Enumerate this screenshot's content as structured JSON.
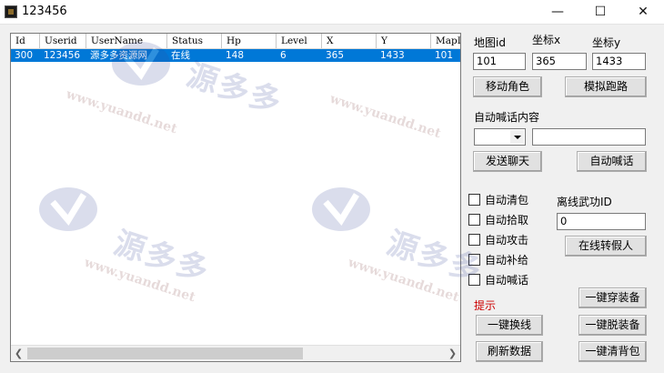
{
  "window": {
    "title": "123456",
    "minimize_glyph": "—",
    "maximize_glyph": "☐",
    "close_glyph": "✕"
  },
  "list": {
    "columns": [
      "Id",
      "Userid",
      "UserName",
      "Status",
      "Hp",
      "Level",
      "X",
      "Y",
      "MapId"
    ],
    "rows": [
      [
        "300",
        "123456",
        "源多多资源网",
        "在线",
        "148",
        "6",
        "365",
        "1433",
        "101"
      ]
    ]
  },
  "panel": {
    "map_id_label": "地图id",
    "x_label": "坐标x",
    "y_label": "坐标y",
    "map_id_value": "101",
    "x_value": "365",
    "y_value": "1433",
    "move_button": "移动角色",
    "sim_run_button": "模拟跑路",
    "shout_content_label": "自动喊话内容",
    "chat_channel_value": "",
    "chat_text_value": "",
    "send_chat_button": "发送聊天",
    "auto_shout_button": "自动喊话",
    "checkboxes": [
      "自动清包",
      "自动拾取",
      "自动攻击",
      "自动补给",
      "自动喊话"
    ],
    "offline_skill_label": "离线武功ID",
    "offline_skill_value": "0",
    "to_fake_button": "在线转假人",
    "hint_label": "提示",
    "equip_all_button": "一键穿装备",
    "switch_line_button": "一键换线",
    "unequip_all_button": "一键脱装备",
    "refresh_button": "刷新数据",
    "clear_bag_button": "一键清背包"
  },
  "watermark": {
    "text": "源多多",
    "url": "www.yuandd.net"
  },
  "colors": {
    "selection": "#0078d7",
    "hint": "#cc0000"
  }
}
